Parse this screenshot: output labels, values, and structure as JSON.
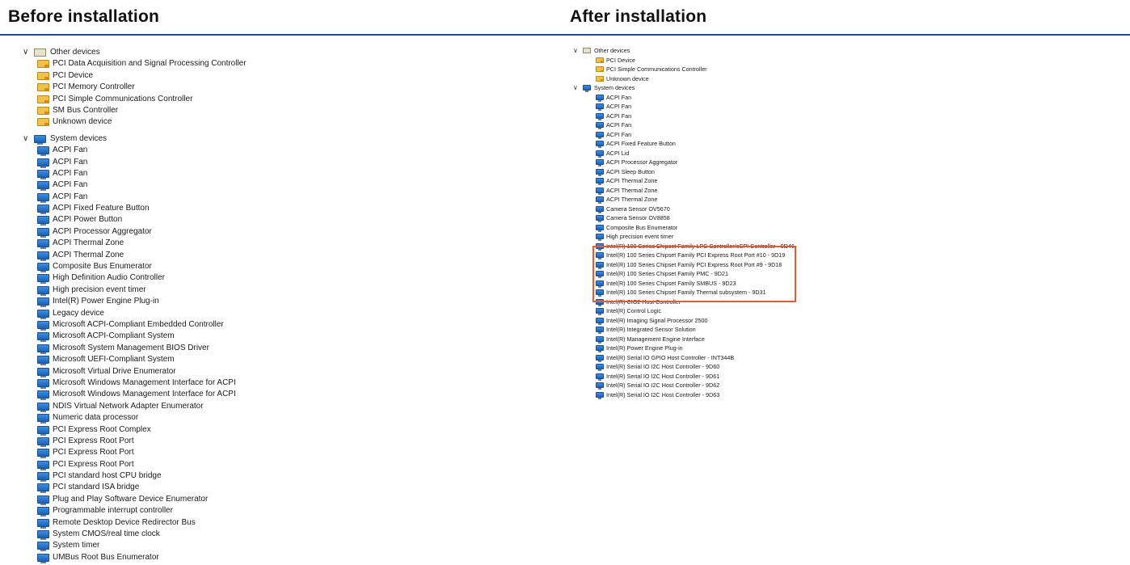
{
  "headers": {
    "before": "Before installation",
    "after": "After installation"
  },
  "before": {
    "other_category": "Other devices",
    "other_devices": [
      "PCI Data Acquisition and Signal Processing Controller",
      "PCI Device",
      "PCI Memory Controller",
      "PCI Simple Communications Controller",
      "SM Bus Controller",
      "Unknown device"
    ],
    "system_category": "System devices",
    "system_devices": [
      "ACPI Fan",
      "ACPI Fan",
      "ACPI Fan",
      "ACPI Fan",
      "ACPI Fan",
      "ACPI Fixed Feature Button",
      "ACPI Power Button",
      "ACPI Processor Aggregator",
      "ACPI Thermal Zone",
      "ACPI Thermal Zone",
      "Composite Bus Enumerator",
      "High Definition Audio Controller",
      "High precision event timer",
      "Intel(R) Power Engine Plug-in",
      "Legacy device",
      "Microsoft ACPI-Compliant Embedded Controller",
      "Microsoft ACPI-Compliant System",
      "Microsoft System Management BIOS Driver",
      "Microsoft UEFI-Compliant System",
      "Microsoft Virtual Drive Enumerator",
      "Microsoft Windows Management Interface for ACPI",
      "Microsoft Windows Management Interface for ACPI",
      "NDIS Virtual Network Adapter Enumerator",
      "Numeric data processor",
      "PCI Express Root Complex",
      "PCI Express Root Port",
      "PCI Express Root Port",
      "PCI Express Root Port",
      "PCI standard host CPU bridge",
      "PCI standard ISA bridge",
      "Plug and Play Software Device Enumerator",
      "Programmable interrupt controller",
      "Remote Desktop Device Redirector Bus",
      "System CMOS/real time clock",
      "System timer",
      "UMBus Root Bus Enumerator"
    ]
  },
  "after": {
    "other_category": "Other devices",
    "other_devices": [
      "PCI Device",
      "PCI Simple Communications Controller",
      "Unknown device"
    ],
    "system_category": "System devices",
    "system_devices": [
      "ACPI Fan",
      "ACPI Fan",
      "ACPI Fan",
      "ACPI Fan",
      "ACPI Fan",
      "ACPI Fixed Feature Button",
      "ACPI Lid",
      "ACPI Processor Aggregator",
      "ACPI Sleep Button",
      "ACPI Thermal Zone",
      "ACPI Thermal Zone",
      "ACPI Thermal Zone",
      "Camera Sensor OV5670",
      "Camera Sensor OV8858",
      "Composite Bus Enumerator",
      "High precision event timer",
      "Intel(R) 100 Series Chipset Family LPC Controller/eSPI Controller - 9D46",
      "Intel(R) 100 Series Chipset Family PCI Express Root Port #10 - 9D19",
      "Intel(R) 100 Series Chipset Family PCI Express Root Port #9 - 9D18",
      "Intel(R) 100 Series Chipset Family PMC - 9D21",
      "Intel(R) 100 Series Chipset Family SMBUS - 9D23",
      "Intel(R) 100 Series Chipset Family Thermal subsystem - 9D31",
      "Intel(R) CIO2 Host Controller",
      "Intel(R) Control Logic",
      "Intel(R) Imaging Signal Processor 2500",
      "Intel(R) Integrated Sensor Solution",
      "Intel(R) Management Engine Interface",
      "Intel(R) Power Engine Plug-in",
      "Intel(R) Serial IO GPIO Host Controller - INT344B",
      "Intel(R) Serial IO I2C Host Controller - 9D60",
      "Intel(R) Serial IO I2C Host Controller - 9D61",
      "Intel(R) Serial IO I2C Host Controller - 9D62",
      "Intel(R) Serial IO I2C Host Controller - 9D63"
    ]
  },
  "icons": {
    "expand": "chevron-down-icon",
    "category_other": "unknown-devices-icon",
    "category_system": "computer-icon",
    "device_other": "warning-device-icon",
    "device_system": "system-device-icon"
  },
  "colors": {
    "header_rule": "#1f4e8c",
    "highlight": "#e05a3c",
    "device_icon": "#2f7bd6"
  }
}
